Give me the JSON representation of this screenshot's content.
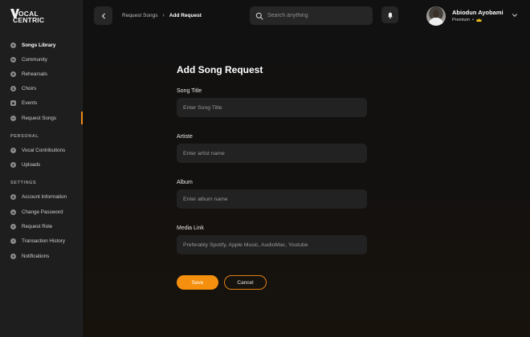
{
  "brand": {
    "line1": "OCAL",
    "line2": "CENTRIC",
    "accent": "#f5900f"
  },
  "sidebar": {
    "main_items": [
      {
        "label": "Songs Library",
        "icon": "music-disc-icon"
      },
      {
        "label": "Community",
        "icon": "community-icon"
      },
      {
        "label": "Rehearsals",
        "icon": "rehearsal-icon"
      },
      {
        "label": "Choirs",
        "icon": "choir-icon"
      },
      {
        "label": "Events",
        "icon": "calendar-icon"
      },
      {
        "label": "Request Songs",
        "icon": "request-icon",
        "active": true
      }
    ],
    "personal_title": "PERSONAL",
    "personal_items": [
      {
        "label": "Vocal Contributions",
        "icon": "microphone-icon"
      },
      {
        "label": "Uploads",
        "icon": "upload-icon"
      }
    ],
    "settings_title": "SETTINGS",
    "settings_items": [
      {
        "label": "Account Information",
        "icon": "account-icon"
      },
      {
        "label": "Change Password",
        "icon": "lock-icon"
      },
      {
        "label": "Request Role",
        "icon": "role-icon"
      },
      {
        "label": "Transaction History",
        "icon": "history-icon"
      },
      {
        "label": "Notifications",
        "icon": "notification-icon"
      }
    ]
  },
  "header": {
    "breadcrumb_parent": "Request Songs",
    "breadcrumb_separator": "›",
    "breadcrumb_current": "Add Request",
    "search_placeholder": "Search anything",
    "user_name": "Abiodun Ayobami",
    "user_plan": "Premium",
    "plan_separator": "•"
  },
  "form": {
    "title": "Add Song Request",
    "fields": [
      {
        "label": "Song Title",
        "value": "",
        "placeholder": "Enter Song Title"
      },
      {
        "label": "Artiste",
        "value": "",
        "placeholder": "Enter artist name"
      },
      {
        "label": "Album",
        "value": "",
        "placeholder": "Enter album name"
      },
      {
        "label": "Media Link",
        "value": "",
        "placeholder": "Preferably Spotify, Apple Music, AudioMac, Youtube"
      }
    ],
    "save_label": "Save",
    "cancel_label": "Cancel"
  }
}
